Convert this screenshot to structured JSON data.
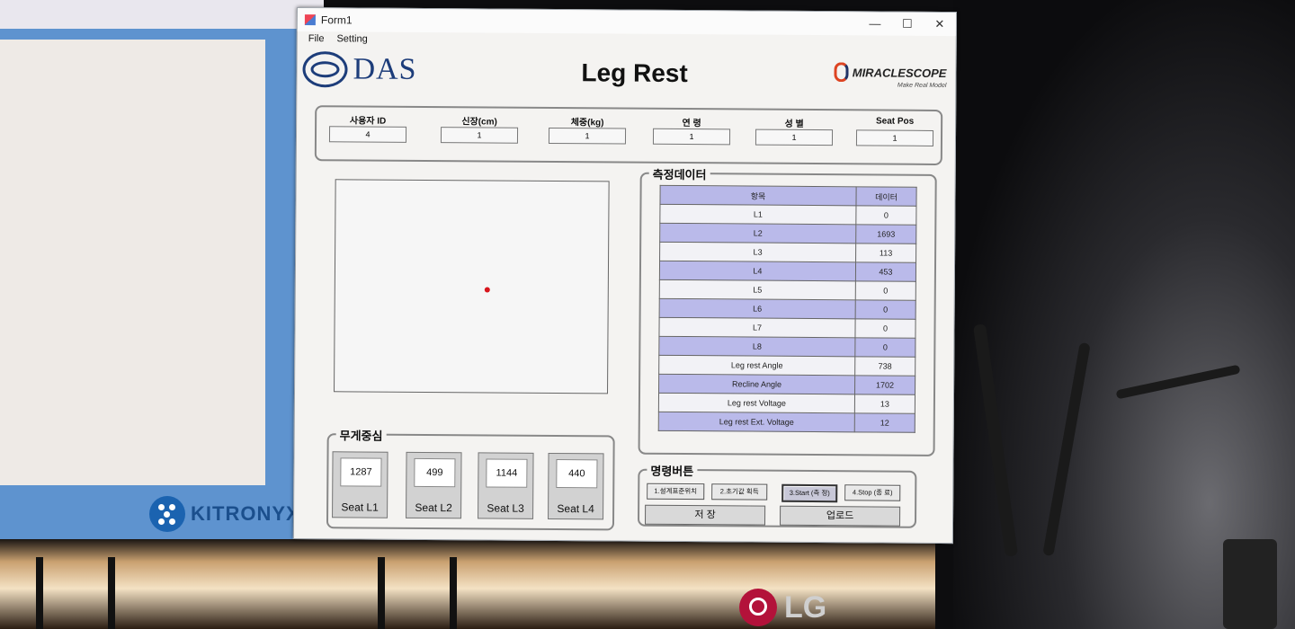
{
  "background": {
    "kitronyx_logo_text": "KITRONYX",
    "lg_logo_text": "LG"
  },
  "window": {
    "title": "Form1",
    "controls": {
      "minimize": "—",
      "maximize": "☐",
      "close": "✕"
    }
  },
  "menu": [
    "File",
    "Setting"
  ],
  "header": {
    "das_logo": "DAS",
    "title": "Leg Rest",
    "miraclescope": "MIRACLESCOPE",
    "miraclescope_tagline": "Make Real Model"
  },
  "user_info": [
    {
      "label": "사용자 ID",
      "value": "4"
    },
    {
      "label": "신장(cm)",
      "value": "1"
    },
    {
      "label": "체중(kg)",
      "value": "1"
    },
    {
      "label": "연 령",
      "value": "1"
    },
    {
      "label": "성 별",
      "value": "1"
    },
    {
      "label": "Seat Pos",
      "value": "1"
    }
  ],
  "cog": {
    "group_label": "무게중심",
    "seats": [
      {
        "label": "Seat L1",
        "value": "1287"
      },
      {
        "label": "Seat L2",
        "value": "499"
      },
      {
        "label": "Seat L3",
        "value": "1144"
      },
      {
        "label": "Seat L4",
        "value": "440"
      }
    ]
  },
  "measurement": {
    "group_label": "측정데이터",
    "headers": [
      "항목",
      "데이터"
    ],
    "rows": [
      {
        "item": "L1",
        "value": "0"
      },
      {
        "item": "L2",
        "value": "1693"
      },
      {
        "item": "L3",
        "value": "113"
      },
      {
        "item": "L4",
        "value": "453"
      },
      {
        "item": "L5",
        "value": "0"
      },
      {
        "item": "L6",
        "value": "0"
      },
      {
        "item": "L7",
        "value": "0"
      },
      {
        "item": "L8",
        "value": "0"
      },
      {
        "item": "Leg rest Angle",
        "value": "738"
      },
      {
        "item": "Recline Angle",
        "value": "1702"
      },
      {
        "item": "Leg rest Voltage",
        "value": "13"
      },
      {
        "item": "Leg rest Ext. Voltage",
        "value": "12"
      }
    ]
  },
  "commands": {
    "group_label": "명령버튼",
    "buttons": [
      "1.설계표준위치",
      "2.초기값 획득",
      "3.Start (측 정)",
      "4.Stop (종 료)"
    ],
    "save": "저 장",
    "upload": "업로드"
  },
  "colors": {
    "row_shade": "#babaea",
    "das_blue": "#1d3d7a",
    "dot_red": "#d8161d"
  }
}
